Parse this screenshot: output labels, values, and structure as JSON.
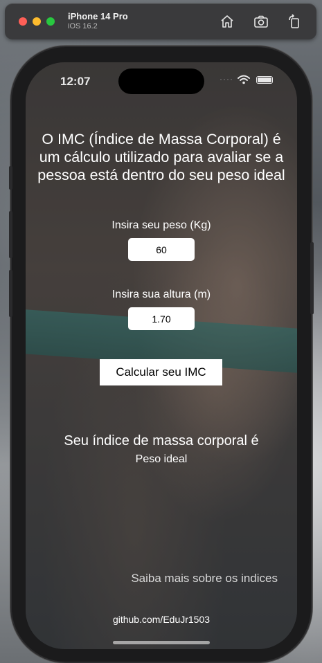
{
  "simulator": {
    "device_name": "iPhone 14 Pro",
    "os_version": "iOS 16.2",
    "icons": [
      "home-icon",
      "screenshot-icon",
      "rotate-icon"
    ]
  },
  "status_bar": {
    "time": "12:07"
  },
  "app": {
    "headline": "O IMC (Índice de Massa Corporal) é um cálculo utilizado para avaliar se a pessoa está dentro do seu peso ideal",
    "weight_label": "Insira seu peso (Kg)",
    "weight_value": "60",
    "height_label": "Insira sua altura (m)",
    "height_value": "1.70",
    "calculate_button": "Calcular seu IMC",
    "result_title": "Seu índice de massa corporal é",
    "result_value": "Peso ideal",
    "more_link": "Saiba mais sobre os indices",
    "footer_link": "github.com/EduJr1503"
  }
}
